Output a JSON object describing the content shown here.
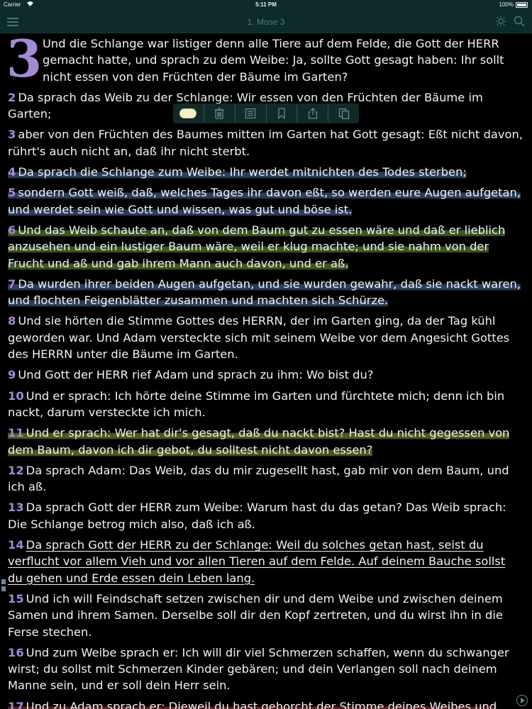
{
  "status_bar": {
    "carrier": "Carrier",
    "time": "5:11 PM",
    "battery": "100%"
  },
  "nav": {
    "title": "1. Mose 3",
    "menu_icon": "hamburger-menu-icon",
    "brightness_icon": "sun-icon",
    "search_icon": "search-icon"
  },
  "chapter": {
    "number": "3",
    "verse1_text": "Und die Schlange war listiger denn alle Tiere auf dem Felde, die Gott der HERR gemacht hatte, und sprach zu dem Weibe: Ja, sollte Gott gesagt haben: Ihr sollt nicht essen von den Früchten der Bäume im Garten?"
  },
  "verses": [
    {
      "num": "2",
      "text": "Da sprach das Weib zu der Schlange: Wir essen von den Früchten der Bäume im Garten;"
    },
    {
      "num": "3",
      "text": "aber von den Früchten des Baumes mitten im Garten hat Gott gesagt: Eßt nicht davon, rührt's auch nicht an, daß ihr nicht sterbt."
    },
    {
      "num": "4",
      "text": "Da sprach die Schlange zum Weibe: Ihr werdet mitnichten des Todes sterben;"
    },
    {
      "num": "5",
      "text": "sondern Gott weiß, daß, welches Tages ihr davon eßt, so werden eure Augen aufgetan, und werdet sein wie Gott und wissen, was gut und böse ist."
    },
    {
      "num": "6",
      "text": "Und das Weib schaute an, daß von dem Baum gut zu essen wäre und daß er lieblich anzusehen und ein lustiger Baum wäre, weil er klug machte; und sie nahm von der Frucht und aß und gab ihrem Mann auch davon, und er aß."
    },
    {
      "num": "7",
      "text": "Da wurden ihrer beiden Augen aufgetan, und sie wurden gewahr, daß sie nackt waren, und flochten Feigenblätter zusammen und machten sich Schürze."
    },
    {
      "num": "8",
      "text": "Und sie hörten die Stimme Gottes des HERRN, der im Garten ging, da der Tag kühl geworden war. Und Adam versteckte sich mit seinem Weibe vor dem Angesicht Gottes des HERRN unter die Bäume im Garten."
    },
    {
      "num": "9",
      "text": "Und Gott der HERR rief Adam und sprach zu ihm: Wo bist du?"
    },
    {
      "num": "10",
      "text": "Und er sprach: Ich hörte deine Stimme im Garten und fürchtete mich; denn ich bin nackt, darum versteckte ich mich."
    },
    {
      "num": "11",
      "text": "Und er sprach: Wer hat dir's gesagt, daß du nackt bist? Hast du nicht gegessen von dem Baum, davon ich dir gebot, du solltest nicht davon essen?"
    },
    {
      "num": "12",
      "text": "Da sprach Adam: Das Weib, das du mir zugesellt hast, gab mir von dem Baum, und ich aß."
    },
    {
      "num": "13",
      "text": "Da sprach Gott der HERR zum Weibe: Warum hast du das getan? Das Weib sprach: Die Schlange betrog mich also, daß ich aß."
    },
    {
      "num": "14",
      "text": "Da sprach Gott der HERR zu der Schlange: Weil du solches getan hast, seist du verflucht vor allem Vieh und vor allen Tieren auf dem Felde. Auf deinem Bauche sollst du gehen und Erde essen dein Leben lang."
    },
    {
      "num": "15",
      "text": "Und ich will Feindschaft setzen zwischen dir und dem Weibe und zwischen deinem Samen und ihrem Samen. Derselbe soll dir den Kopf zertreten, und du wirst ihn in die Ferse stechen."
    },
    {
      "num": "16",
      "text": "Und zum Weibe sprach er: Ich will dir viel Schmerzen schaffen, wenn du schwanger wirst; du sollst mit Schmerzen Kinder gebären; und dein Verlangen soll nach deinem Manne sein, und er soll dein Herr sein."
    },
    {
      "num": "17",
      "text": "Und zu Adam sprach er: Dieweil du hast gehorcht der Stimme deines Weibes und hast gegessen von dem Baum, davon ich dir gebot und sprach: Du sollst nicht davon"
    }
  ],
  "toolbar": {
    "icons": [
      "highlight-color-icon",
      "trash-icon",
      "note-icon",
      "bookmark-icon",
      "share-icon",
      "copy-icon"
    ]
  },
  "colors": {
    "verse_number": "#a58bd4",
    "highlight_blue": "#2c3e5c",
    "highlight_green": "#3c5626",
    "highlight_olive": "#4f5820",
    "highlight_red": "#5a2222",
    "nav_background": "#0d2b2b"
  }
}
